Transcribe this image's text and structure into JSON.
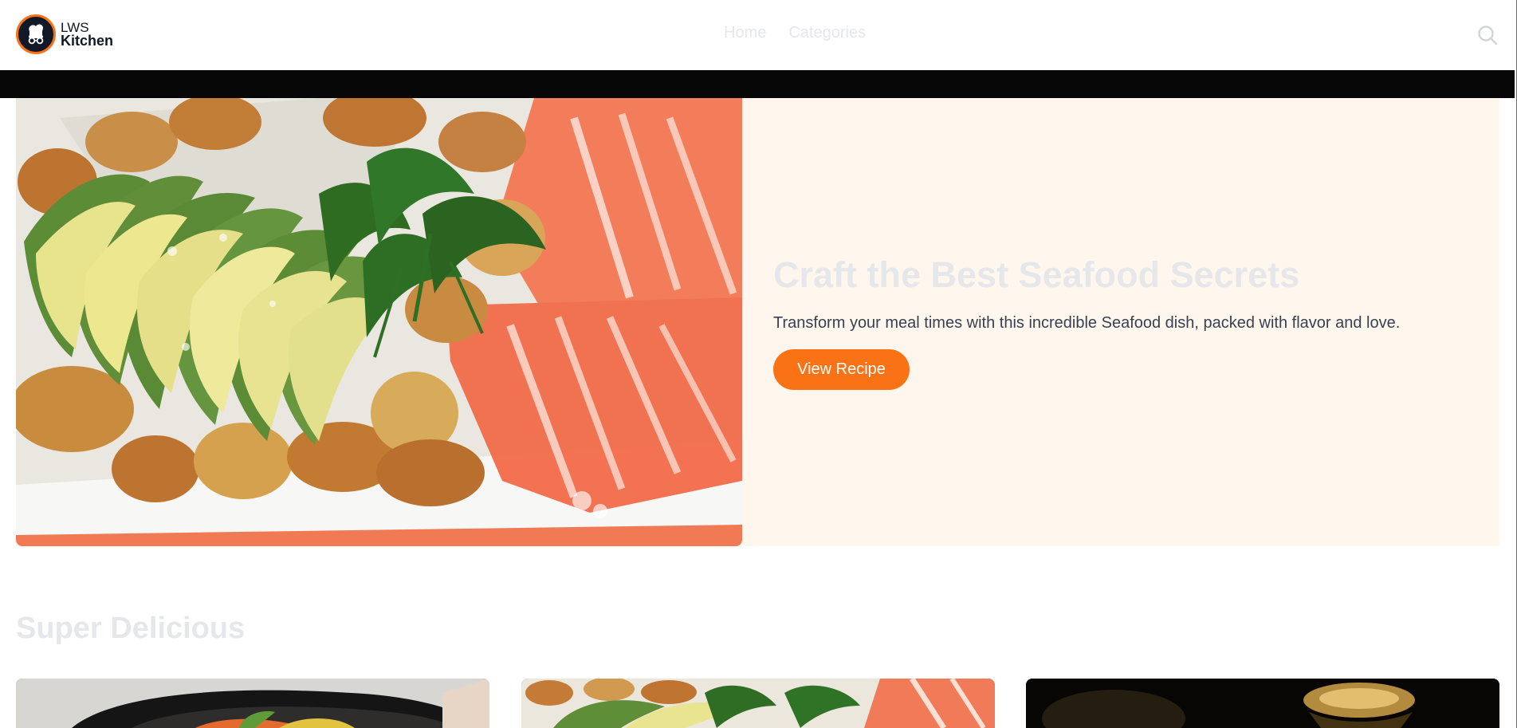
{
  "header": {
    "logo_top": "LWS",
    "logo_bottom": "Kitchen",
    "nav": [
      {
        "label": "Home"
      },
      {
        "label": "Categories"
      }
    ],
    "search_icon": "search-icon"
  },
  "hero": {
    "title": "Craft the Best Seafood Secrets",
    "description": "Transform your meal times with this incredible Seafood dish, packed with flavor and love.",
    "button_label": "View Recipe",
    "image": "seafood-platter-image"
  },
  "section": {
    "title": "Super Delicious"
  },
  "cards": [
    {
      "image": "vegetable-dish-image"
    },
    {
      "image": "seafood-platter-image"
    },
    {
      "image": "golden-dish-image"
    }
  ],
  "colors": {
    "accent": "#f97316",
    "hero_background": "#fff7ed",
    "band": "#070707",
    "muted_text": "#e5e7eb",
    "body_text": "#374151"
  }
}
